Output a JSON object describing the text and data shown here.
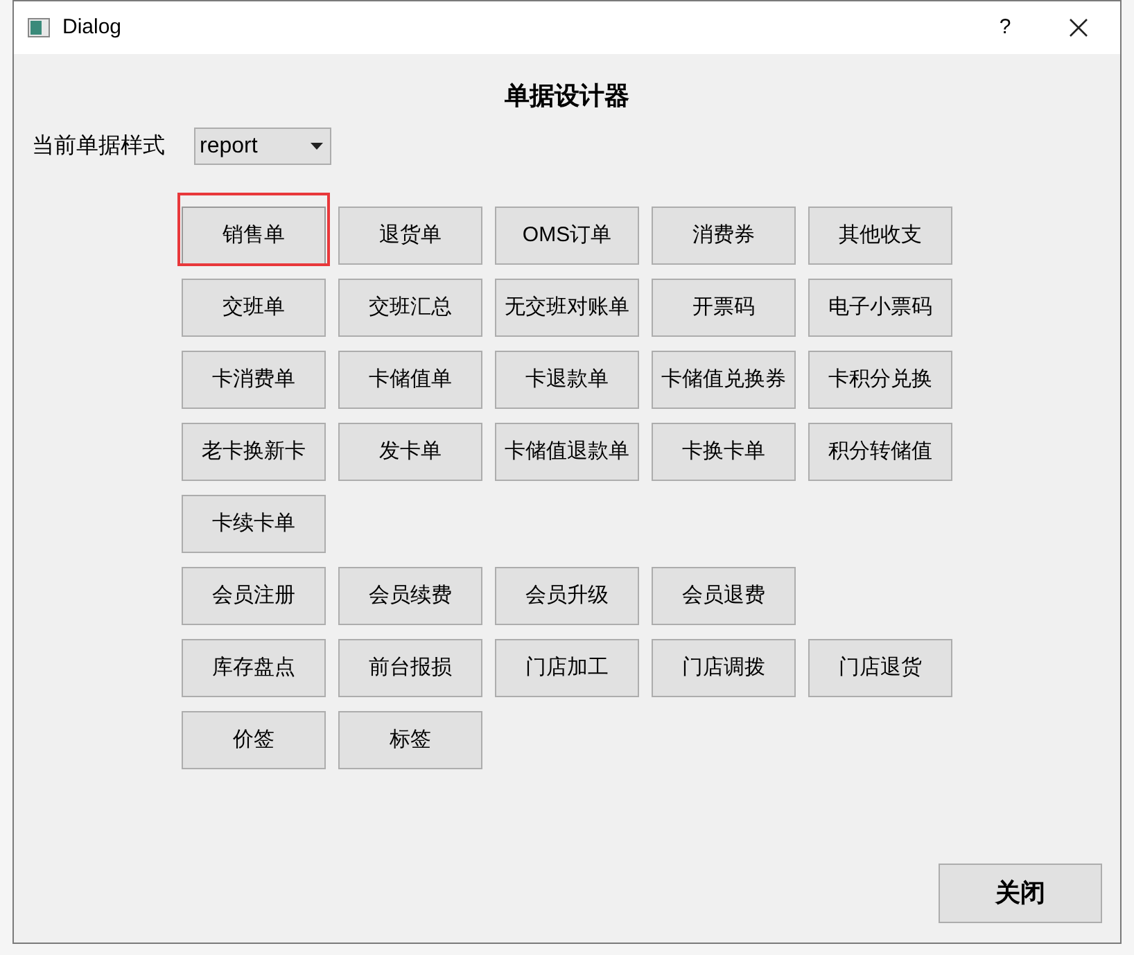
{
  "window": {
    "title": "Dialog",
    "help": "?"
  },
  "heading": "单据设计器",
  "style_field": {
    "label": "当前单据样式",
    "value": "report"
  },
  "button_rows": [
    [
      {
        "label": "销售单",
        "selected": true
      },
      {
        "label": "退货单",
        "selected": false
      },
      {
        "label": "OMS订单",
        "selected": false
      },
      {
        "label": "消费券",
        "selected": false
      },
      {
        "label": "其他收支",
        "selected": false
      }
    ],
    [
      {
        "label": "交班单",
        "selected": false
      },
      {
        "label": "交班汇总",
        "selected": false
      },
      {
        "label": "无交班对账单",
        "selected": false
      },
      {
        "label": "开票码",
        "selected": false
      },
      {
        "label": "电子小票码",
        "selected": false
      }
    ],
    [
      {
        "label": "卡消费单",
        "selected": false
      },
      {
        "label": "卡储值单",
        "selected": false
      },
      {
        "label": "卡退款单",
        "selected": false
      },
      {
        "label": "卡储值兑换券",
        "selected": false
      },
      {
        "label": "卡积分兑换",
        "selected": false
      }
    ],
    [
      {
        "label": "老卡换新卡",
        "selected": false
      },
      {
        "label": "发卡单",
        "selected": false
      },
      {
        "label": "卡储值退款单",
        "selected": false
      },
      {
        "label": "卡换卡单",
        "selected": false
      },
      {
        "label": "积分转储值",
        "selected": false
      }
    ],
    [
      {
        "label": "卡续卡单",
        "selected": false
      }
    ],
    [
      {
        "label": "会员注册",
        "selected": false
      },
      {
        "label": "会员续费",
        "selected": false
      },
      {
        "label": "会员升级",
        "selected": false
      },
      {
        "label": "会员退费",
        "selected": false
      }
    ],
    [
      {
        "label": "库存盘点",
        "selected": false
      },
      {
        "label": "前台报损",
        "selected": false
      },
      {
        "label": "门店加工",
        "selected": false
      },
      {
        "label": "门店调拨",
        "selected": false
      },
      {
        "label": "门店退货",
        "selected": false
      }
    ],
    [
      {
        "label": "价签",
        "selected": false
      },
      {
        "label": "标签",
        "selected": false
      }
    ]
  ],
  "close_button": "关闭"
}
